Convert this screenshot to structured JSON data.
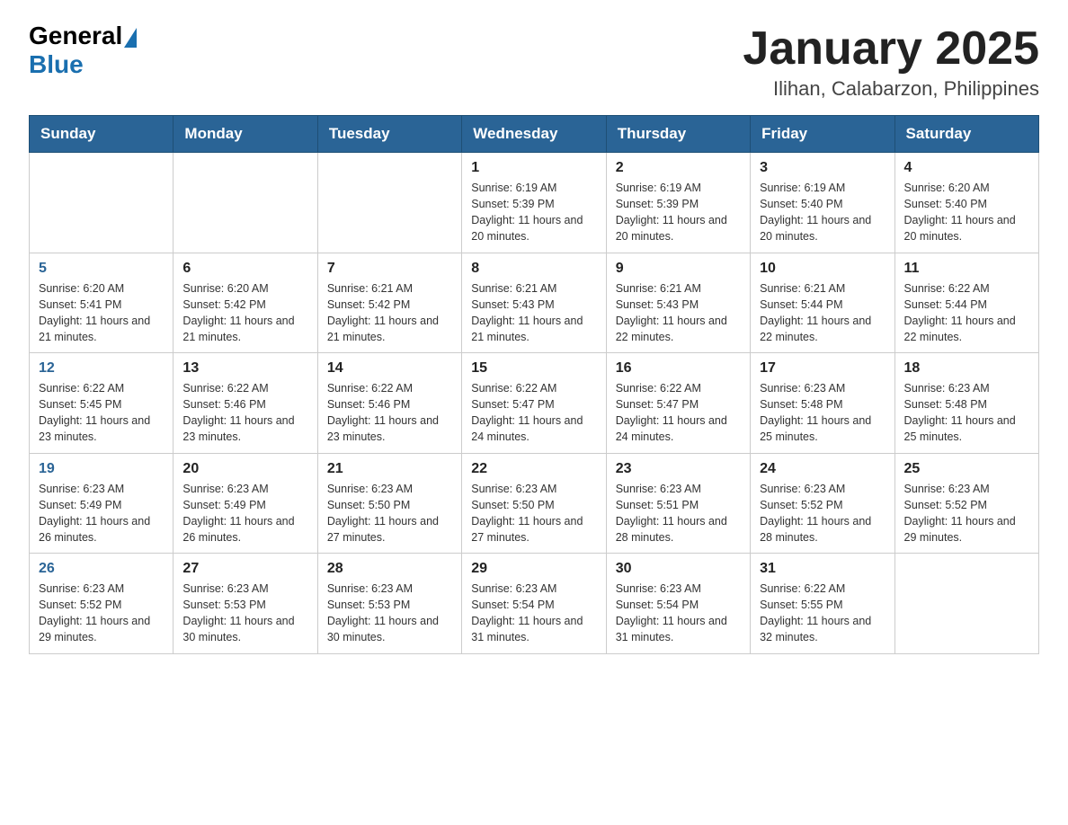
{
  "header": {
    "logo_general": "General",
    "logo_blue": "Blue",
    "title": "January 2025",
    "subtitle": "Ilihan, Calabarzon, Philippines"
  },
  "days_of_week": [
    "Sunday",
    "Monday",
    "Tuesday",
    "Wednesday",
    "Thursday",
    "Friday",
    "Saturday"
  ],
  "weeks": [
    [
      {
        "day": "",
        "info": ""
      },
      {
        "day": "",
        "info": ""
      },
      {
        "day": "",
        "info": ""
      },
      {
        "day": "1",
        "info": "Sunrise: 6:19 AM\nSunset: 5:39 PM\nDaylight: 11 hours and 20 minutes."
      },
      {
        "day": "2",
        "info": "Sunrise: 6:19 AM\nSunset: 5:39 PM\nDaylight: 11 hours and 20 minutes."
      },
      {
        "day": "3",
        "info": "Sunrise: 6:19 AM\nSunset: 5:40 PM\nDaylight: 11 hours and 20 minutes."
      },
      {
        "day": "4",
        "info": "Sunrise: 6:20 AM\nSunset: 5:40 PM\nDaylight: 11 hours and 20 minutes."
      }
    ],
    [
      {
        "day": "5",
        "info": "Sunrise: 6:20 AM\nSunset: 5:41 PM\nDaylight: 11 hours and 21 minutes."
      },
      {
        "day": "6",
        "info": "Sunrise: 6:20 AM\nSunset: 5:42 PM\nDaylight: 11 hours and 21 minutes."
      },
      {
        "day": "7",
        "info": "Sunrise: 6:21 AM\nSunset: 5:42 PM\nDaylight: 11 hours and 21 minutes."
      },
      {
        "day": "8",
        "info": "Sunrise: 6:21 AM\nSunset: 5:43 PM\nDaylight: 11 hours and 21 minutes."
      },
      {
        "day": "9",
        "info": "Sunrise: 6:21 AM\nSunset: 5:43 PM\nDaylight: 11 hours and 22 minutes."
      },
      {
        "day": "10",
        "info": "Sunrise: 6:21 AM\nSunset: 5:44 PM\nDaylight: 11 hours and 22 minutes."
      },
      {
        "day": "11",
        "info": "Sunrise: 6:22 AM\nSunset: 5:44 PM\nDaylight: 11 hours and 22 minutes."
      }
    ],
    [
      {
        "day": "12",
        "info": "Sunrise: 6:22 AM\nSunset: 5:45 PM\nDaylight: 11 hours and 23 minutes."
      },
      {
        "day": "13",
        "info": "Sunrise: 6:22 AM\nSunset: 5:46 PM\nDaylight: 11 hours and 23 minutes."
      },
      {
        "day": "14",
        "info": "Sunrise: 6:22 AM\nSunset: 5:46 PM\nDaylight: 11 hours and 23 minutes."
      },
      {
        "day": "15",
        "info": "Sunrise: 6:22 AM\nSunset: 5:47 PM\nDaylight: 11 hours and 24 minutes."
      },
      {
        "day": "16",
        "info": "Sunrise: 6:22 AM\nSunset: 5:47 PM\nDaylight: 11 hours and 24 minutes."
      },
      {
        "day": "17",
        "info": "Sunrise: 6:23 AM\nSunset: 5:48 PM\nDaylight: 11 hours and 25 minutes."
      },
      {
        "day": "18",
        "info": "Sunrise: 6:23 AM\nSunset: 5:48 PM\nDaylight: 11 hours and 25 minutes."
      }
    ],
    [
      {
        "day": "19",
        "info": "Sunrise: 6:23 AM\nSunset: 5:49 PM\nDaylight: 11 hours and 26 minutes."
      },
      {
        "day": "20",
        "info": "Sunrise: 6:23 AM\nSunset: 5:49 PM\nDaylight: 11 hours and 26 minutes."
      },
      {
        "day": "21",
        "info": "Sunrise: 6:23 AM\nSunset: 5:50 PM\nDaylight: 11 hours and 27 minutes."
      },
      {
        "day": "22",
        "info": "Sunrise: 6:23 AM\nSunset: 5:50 PM\nDaylight: 11 hours and 27 minutes."
      },
      {
        "day": "23",
        "info": "Sunrise: 6:23 AM\nSunset: 5:51 PM\nDaylight: 11 hours and 28 minutes."
      },
      {
        "day": "24",
        "info": "Sunrise: 6:23 AM\nSunset: 5:52 PM\nDaylight: 11 hours and 28 minutes."
      },
      {
        "day": "25",
        "info": "Sunrise: 6:23 AM\nSunset: 5:52 PM\nDaylight: 11 hours and 29 minutes."
      }
    ],
    [
      {
        "day": "26",
        "info": "Sunrise: 6:23 AM\nSunset: 5:52 PM\nDaylight: 11 hours and 29 minutes."
      },
      {
        "day": "27",
        "info": "Sunrise: 6:23 AM\nSunset: 5:53 PM\nDaylight: 11 hours and 30 minutes."
      },
      {
        "day": "28",
        "info": "Sunrise: 6:23 AM\nSunset: 5:53 PM\nDaylight: 11 hours and 30 minutes."
      },
      {
        "day": "29",
        "info": "Sunrise: 6:23 AM\nSunset: 5:54 PM\nDaylight: 11 hours and 31 minutes."
      },
      {
        "day": "30",
        "info": "Sunrise: 6:23 AM\nSunset: 5:54 PM\nDaylight: 11 hours and 31 minutes."
      },
      {
        "day": "31",
        "info": "Sunrise: 6:22 AM\nSunset: 5:55 PM\nDaylight: 11 hours and 32 minutes."
      },
      {
        "day": "",
        "info": ""
      }
    ]
  ]
}
